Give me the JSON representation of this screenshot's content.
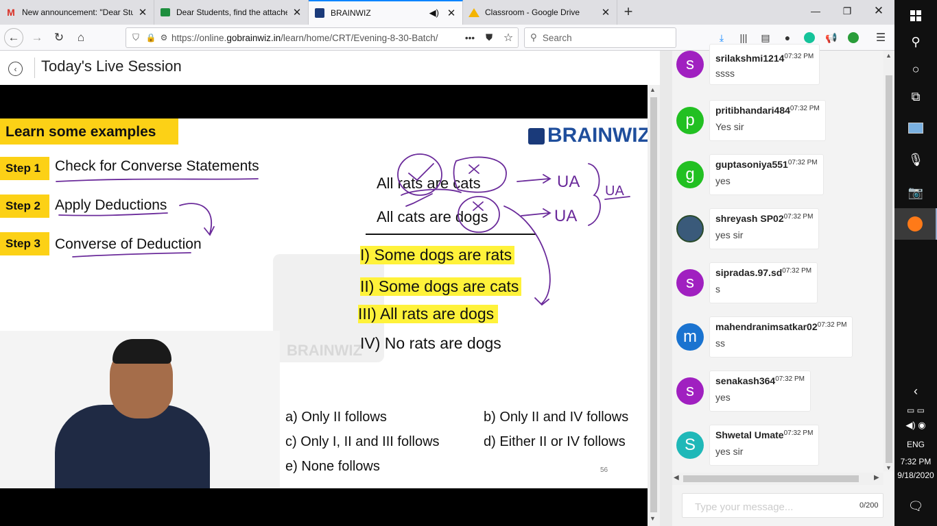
{
  "browser": {
    "tabs": [
      {
        "title": "New announcement: \"Dear Stu",
        "icon": "gmail-icon"
      },
      {
        "title": "Dear Students, find the attache",
        "icon": "classroom-icon"
      },
      {
        "title": "BRAINWIZ",
        "icon": "brainwiz-icon",
        "active": true
      },
      {
        "title": "Classroom - Google Drive",
        "icon": "drive-icon"
      }
    ],
    "url_prefix": "https://online.",
    "url_domain": "gobrainwiz.in",
    "url_path": "/learn/home/CRT/Evening-8-30-Batch/",
    "url_more": "•••",
    "search_placeholder": "Search"
  },
  "page": {
    "title": "Today's Live Session"
  },
  "slide": {
    "heading": "Learn some examples",
    "logo_text": "BRAINWIZ",
    "watermark_text": "BRAINWIZ",
    "steps": [
      {
        "label": "Step 1",
        "text": "Check for Converse Statements"
      },
      {
        "label": "Step 2",
        "text": "Apply Deductions"
      },
      {
        "label": "Step 3",
        "text": "Converse of Deduction"
      }
    ],
    "premises": [
      "All rats are cats",
      "All cats are dogs"
    ],
    "conclusions": [
      "I) Some dogs are rats",
      "II) Some dogs are cats",
      "III) All rats are dogs",
      "IV) No rats are dogs"
    ],
    "options": [
      "a) Only II follows",
      "b) Only II and IV follows",
      "c) Only I, II and III follows",
      "d) Either II or IV follows",
      "e) None follows"
    ],
    "page_number": "56",
    "annotations": [
      "UA",
      "UA",
      "UA"
    ]
  },
  "chat": {
    "messages": [
      {
        "initial": "s",
        "user": "srilakshmi1214",
        "time": "07:32 PM",
        "text": "ssss",
        "color": "#a020c0"
      },
      {
        "initial": "p",
        "user": "pritibhandari484",
        "time": "07:32 PM",
        "text": "Yes sir",
        "color": "#22c022"
      },
      {
        "initial": "g",
        "user": "guptasoniya551",
        "time": "07:32 PM",
        "text": "yes",
        "color": "#22c022"
      },
      {
        "initial": "",
        "user": "shreyash SP02",
        "time": "07:32 PM",
        "text": "yes sir",
        "color": "#3a5a7a"
      },
      {
        "initial": "s",
        "user": "sipradas.97.sd",
        "time": "07:32 PM",
        "text": "s",
        "color": "#a020c0"
      },
      {
        "initial": "m",
        "user": "mahendranimsatkar02",
        "time": "07:32 PM",
        "text": "ss",
        "color": "#1a73d0"
      },
      {
        "initial": "s",
        "user": "senakash364",
        "time": "07:32 PM",
        "text": "yes",
        "color": "#a020c0"
      },
      {
        "initial": "S",
        "user": "Shwetal Umate",
        "time": "07:32 PM",
        "text": "yes sir",
        "color": "#1fb8b8"
      }
    ],
    "input_placeholder": "Type your message...",
    "char_count": "0/200"
  },
  "taskbar": {
    "language": "ENG",
    "time": "7:32 PM",
    "date": "9/18/2020"
  }
}
